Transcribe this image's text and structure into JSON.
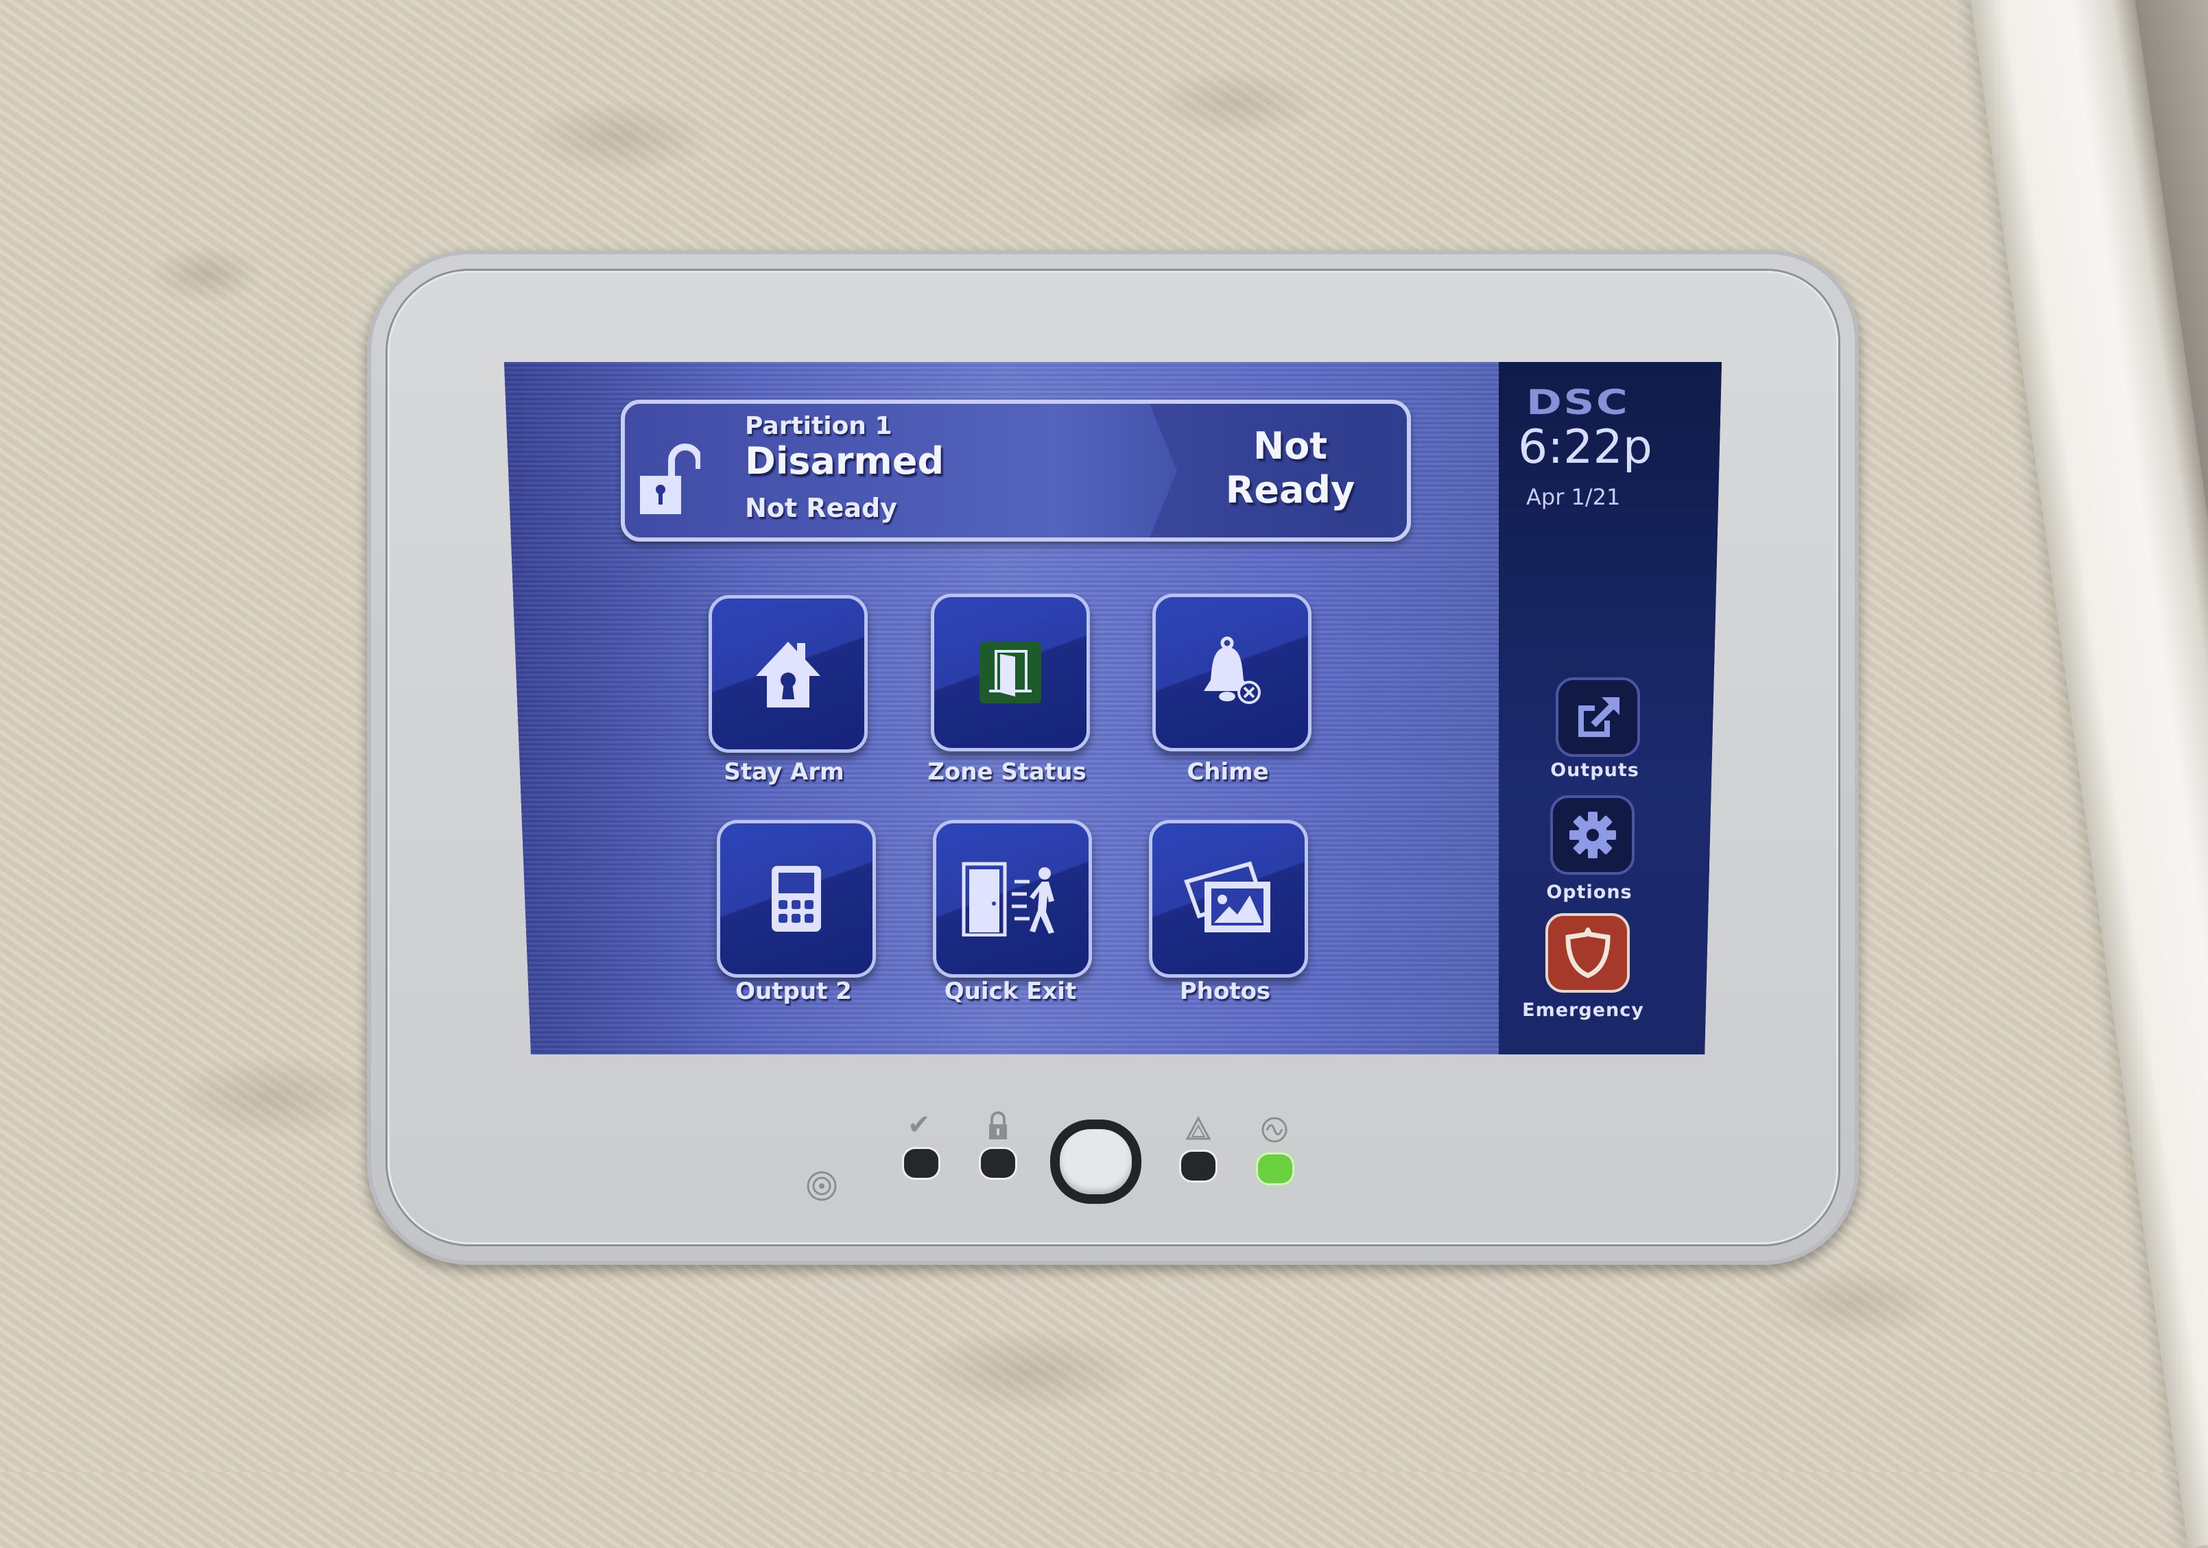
{
  "device": {
    "brand": "DSC",
    "time": "6:22p",
    "date": "Apr 1/21",
    "accent_color": "#5a68c2",
    "emergency_color": "#a53a2a",
    "power_led_color": "#6bd040"
  },
  "status": {
    "partition": "Partition 1",
    "arm_state": "Disarmed",
    "readiness": "Not Ready",
    "readiness_banner": "Not Ready",
    "lock_icon": "unlocked-padlock-icon"
  },
  "tiles": [
    {
      "label": "Stay Arm",
      "icon": "house-keyhole-icon"
    },
    {
      "label": "Zone Status",
      "icon": "door-icon"
    },
    {
      "label": "Chime",
      "icon": "bell-off-icon"
    },
    {
      "label": "Output 2",
      "icon": "keypad-icon"
    },
    {
      "label": "Quick Exit",
      "icon": "door-exit-person-icon"
    },
    {
      "label": "Photos",
      "icon": "photos-icon"
    }
  ],
  "sidebar": [
    {
      "label": "Outputs",
      "icon": "external-link-icon"
    },
    {
      "label": "Options",
      "icon": "gear-icon"
    },
    {
      "label": "Emergency",
      "icon": "shield-icon"
    }
  ],
  "indicators": [
    {
      "name": "ready",
      "symbol": "✔",
      "state": "off"
    },
    {
      "name": "armed",
      "symbol": "lock",
      "state": "off"
    },
    {
      "name": "trouble",
      "symbol": "⚠",
      "state": "off"
    },
    {
      "name": "ac-power",
      "symbol": "~",
      "state": "on"
    }
  ]
}
